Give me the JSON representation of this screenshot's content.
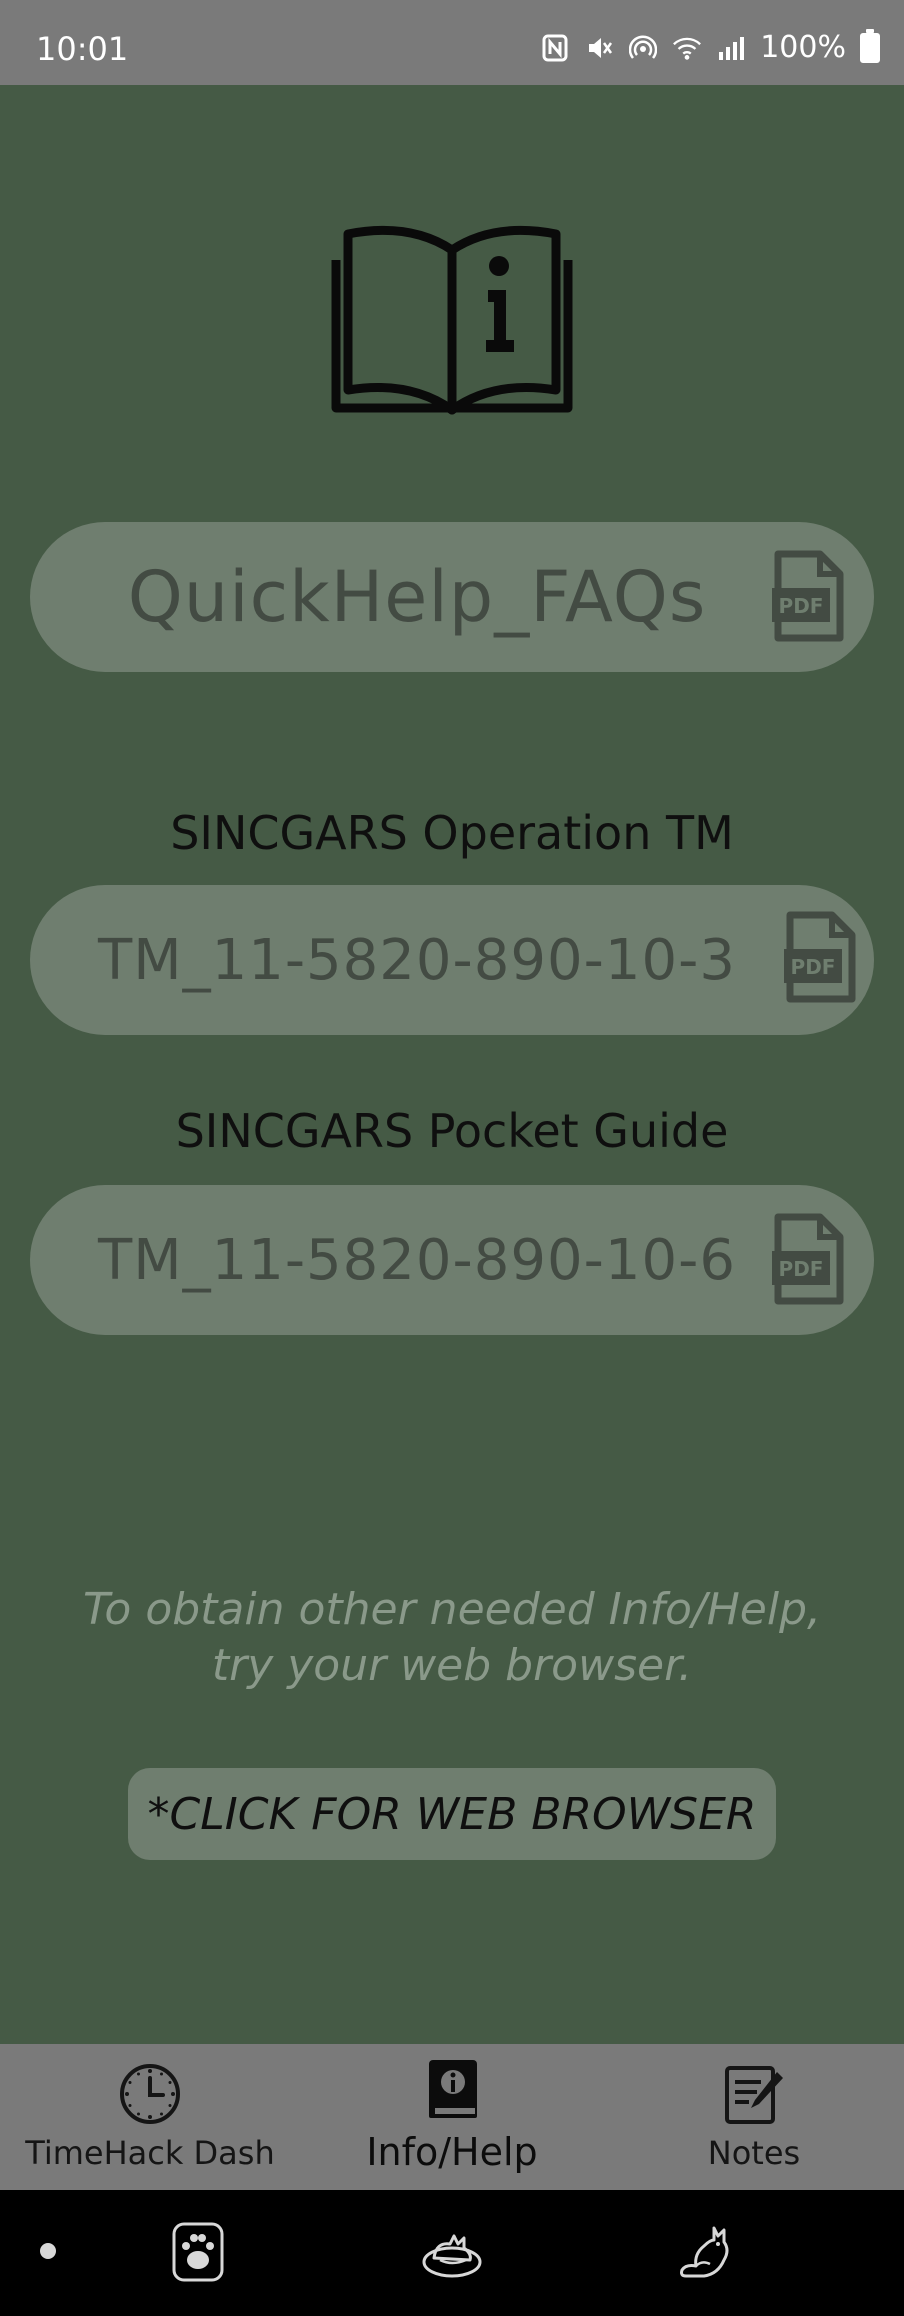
{
  "status_bar": {
    "time": "10:01",
    "battery": "100%",
    "icons": [
      "nfc-icon",
      "mute-icon",
      "hotspot-icon",
      "wifi-icon",
      "signal-icon",
      "battery-icon"
    ]
  },
  "header": {
    "icon": "book-info-icon"
  },
  "quickhelp": {
    "label": "QuickHelp_FAQs",
    "icon": "pdf-icon"
  },
  "operation_tm": {
    "section_label": "SINCGARS Operation TM",
    "label": "TM_11-5820-890-10-3",
    "icon": "pdf-icon"
  },
  "pocket_guide": {
    "section_label": "SINCGARS Pocket Guide",
    "label": "TM_11-5820-890-10-6",
    "icon": "pdf-icon"
  },
  "info_text": "To obtain other needed Info/Help, try your web browser.",
  "web_button": {
    "label": "*CLICK FOR WEB BROWSER"
  },
  "bottom_nav": {
    "items": [
      {
        "label": "TimeHack Dash",
        "icon": "clock-icon",
        "active": false
      },
      {
        "label": "Info/Help",
        "icon": "info-book-icon",
        "active": true
      },
      {
        "label": "Notes",
        "icon": "notes-icon",
        "active": false
      }
    ]
  },
  "system_nav": {
    "icons": [
      "paw-icon",
      "cat-bed-icon",
      "cat-icon"
    ]
  },
  "colors": {
    "background": "#455a45",
    "pill": "#6f7e6f",
    "pill_text": "#434b43",
    "nav_bar": "#7a7a7a",
    "info_text": "#8a998a"
  }
}
